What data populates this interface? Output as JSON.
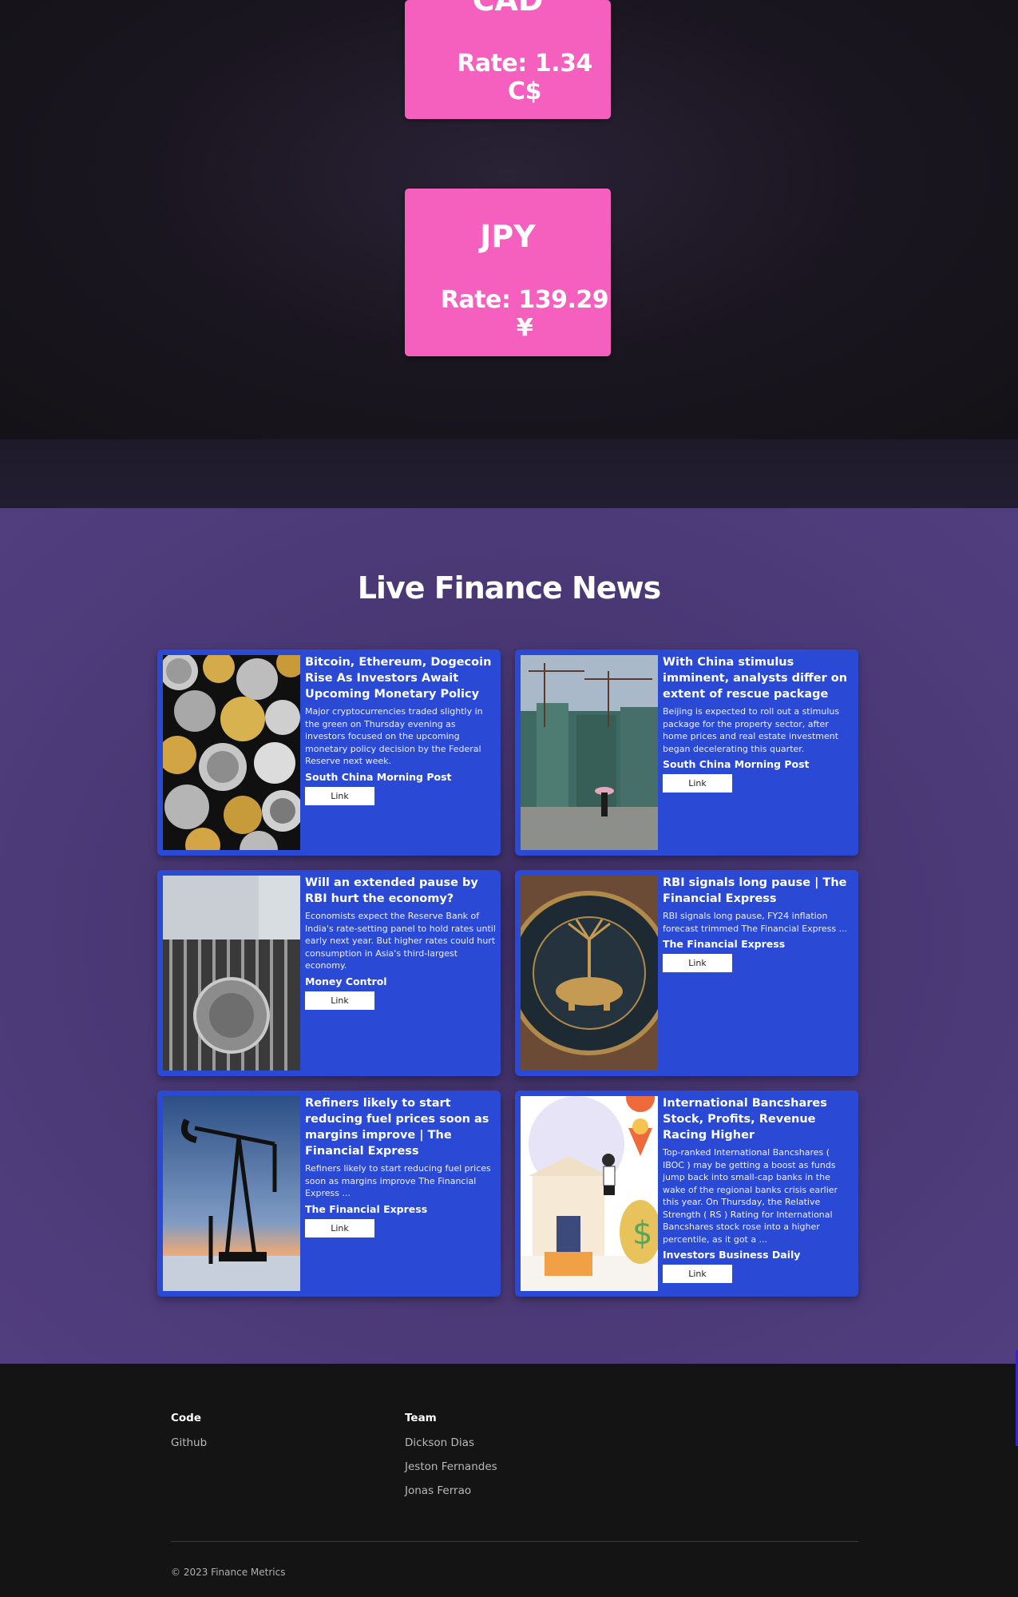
{
  "rates": [
    {
      "code": "CAD",
      "rate_text": "Rate: 1.34 C$"
    },
    {
      "code": "JPY",
      "rate_text": "Rate: 139.29 ¥"
    }
  ],
  "news": {
    "title": "Live Finance News",
    "articles": [
      {
        "headline": "Bitcoin, Ethereum, Dogecoin Rise As Investors Await Upcoming Monetary Policy",
        "description": "Major cryptocurrencies traded slightly in the green on Thursday evening as investors focused on the upcoming monetary policy decision by the Federal Reserve next week.",
        "source": "South China Morning Post",
        "link_label": "Link",
        "image": "crypto-coins-image"
      },
      {
        "headline": "With China stimulus imminent, analysts differ on extent of rescue package",
        "description": "Beijing is expected to roll out a stimulus package for the property sector, after home prices and real estate investment began decelerating this quarter.",
        "source": "South China Morning Post",
        "link_label": "Link",
        "image": "construction-cranes-image"
      },
      {
        "headline": "Will an extended pause by RBI hurt the economy?",
        "description": "Economists expect the Reserve Bank of India's rate-setting panel to hold rates until early next year. But higher rates could hurt consumption in Asia's third-largest economy.",
        "source": "Money Control",
        "link_label": "Link",
        "image": "rbi-gate-image"
      },
      {
        "headline": "RBI signals long pause | The Financial Express",
        "description": "RBI signals long pause, FY24 inflation forecast trimmed The Financial Express ...",
        "source": "The Financial Express",
        "link_label": "Link",
        "image": "rbi-emblem-image"
      },
      {
        "headline": "Refiners likely to start reducing fuel prices soon as margins improve | The Financial Express",
        "description": "Refiners likely to start reducing fuel prices soon as margins improve The Financial Express ...",
        "source": "The Financial Express",
        "link_label": "Link",
        "image": "oil-pump-image"
      },
      {
        "headline": "International Bancshares Stock, Profits, Revenue Racing Higher",
        "description": "Top-ranked International Bancshares ( IBOC ) may be getting a boost as funds jump back into small-cap banks in the wake of the regional banks crisis earlier this year. On Thursday, the Relative Strength ( RS ) Rating for International Bancshares stock rose into a higher percentile, as it got a ...",
        "source": "Investors Business Daily",
        "link_label": "Link",
        "image": "bank-illustration-image"
      }
    ]
  },
  "footer": {
    "code_heading": "Code",
    "code_links": [
      "Github"
    ],
    "team_heading": "Team",
    "team_links": [
      "Dickson Dias",
      "Jeston Fernandes",
      "Jonas Ferrao"
    ],
    "copyright": "© 2023 Finance Metrics"
  }
}
